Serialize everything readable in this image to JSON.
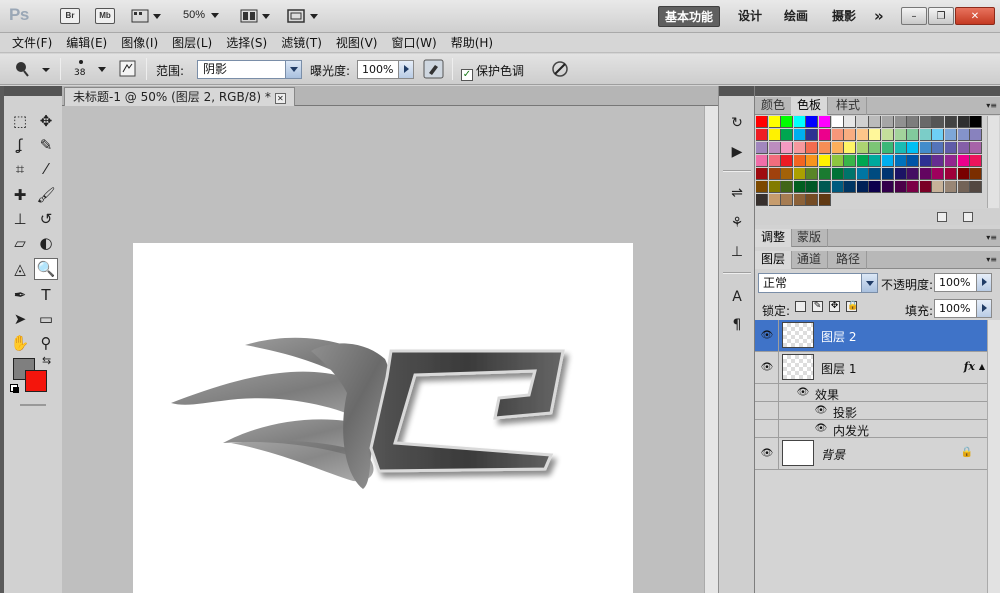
{
  "app": {
    "logo": "Ps",
    "bridge": "Br",
    "mini_bridge": "Mb",
    "zoom": "50%",
    "workspaces": [
      "基本功能",
      "设计",
      "绘画",
      "摄影"
    ],
    "more": "»"
  },
  "window_controls": {
    "minimize": "–",
    "restore": "❐",
    "close": "✕"
  },
  "menu": [
    "文件(F)",
    "编辑(E)",
    "图像(I)",
    "图层(L)",
    "选择(S)",
    "滤镜(T)",
    "视图(V)",
    "窗口(W)",
    "帮助(H)"
  ],
  "options": {
    "brush_size": "38",
    "range_label": "范围:",
    "range_value": "阴影",
    "exposure_label": "曝光度:",
    "exposure_value": "100%",
    "protect_tones_label": "保护色调",
    "protect_tones_checked": true
  },
  "document": {
    "tab_title": "未标题-1 @ 50% (图层 2, RGB/8) *",
    "close": "✕"
  },
  "tools": [
    {
      "name": "marquee-icon",
      "glyph": "⬚"
    },
    {
      "name": "move-icon",
      "glyph": "✥"
    },
    {
      "name": "lasso-icon",
      "glyph": "ʆ"
    },
    {
      "name": "quick-select-icon",
      "glyph": "✎"
    },
    {
      "name": "crop-icon",
      "glyph": "⌗"
    },
    {
      "name": "eyedropper-icon",
      "glyph": "⁄"
    },
    {
      "name": "healing-brush-icon",
      "glyph": "✚"
    },
    {
      "name": "brush-icon",
      "glyph": "🖌"
    },
    {
      "name": "clone-stamp-icon",
      "glyph": "⊥"
    },
    {
      "name": "history-brush-icon",
      "glyph": "↺"
    },
    {
      "name": "eraser-icon",
      "glyph": "▱"
    },
    {
      "name": "paint-bucket-icon",
      "glyph": "◐"
    },
    {
      "name": "blur-icon",
      "glyph": "◬"
    },
    {
      "name": "dodge-burn-icon",
      "glyph": "🔍"
    },
    {
      "name": "pen-icon",
      "glyph": "✒"
    },
    {
      "name": "type-icon",
      "glyph": "T"
    },
    {
      "name": "path-select-icon",
      "glyph": "➤"
    },
    {
      "name": "shape-icon",
      "glyph": "▭"
    },
    {
      "name": "hand-icon",
      "glyph": "✋"
    },
    {
      "name": "zoom-icon",
      "glyph": "⚲"
    }
  ],
  "colors": {
    "foreground": "#7f7f7f",
    "background": "#f4150c",
    "accent_selection": "#3f73c8"
  },
  "panels": {
    "swatch_tabs": [
      "颜色",
      "色板",
      "样式"
    ],
    "adjust_tabs": [
      "调整",
      "蒙版"
    ],
    "layer_tabs": [
      "图层",
      "通道",
      "路径"
    ],
    "blend_mode": "正常",
    "opacity_label": "不透明度:",
    "opacity_value": "100%",
    "lock_label": "锁定:",
    "fill_label": "填充:",
    "fill_value": "100%"
  },
  "layers": [
    {
      "name": "图层 2",
      "selected": true,
      "type": "layer"
    },
    {
      "name": "图层 1",
      "selected": false,
      "type": "layer",
      "fx": "fx"
    },
    {
      "name": "效果",
      "type": "effects-header"
    },
    {
      "name": "投影",
      "type": "effect"
    },
    {
      "name": "内发光",
      "type": "effect"
    },
    {
      "name": "背景",
      "selected": false,
      "type": "background"
    }
  ],
  "dock_icons": [
    "history-icon",
    "actions-icon",
    "brush-presets-icon",
    "clone-source-icon",
    "tool-presets-icon",
    "character-icon",
    "paragraph-icon"
  ],
  "swatch_colors": [
    "#ff0000",
    "#ffff00",
    "#00ff00",
    "#00ffff",
    "#0000ff",
    "#ff00ff",
    "#ffffff",
    "#e6e6e6",
    "#d0d0d0",
    "#bbbbbb",
    "#a6a6a6",
    "#919191",
    "#7d7d7d",
    "#696969",
    "#555555",
    "#424242",
    "#2f2f2f",
    "#000000",
    "#ee1d24",
    "#fff200",
    "#00a650",
    "#00aeef",
    "#2e3192",
    "#ec008c",
    "#f7977a",
    "#f9ad81",
    "#fdc68a",
    "#fff79a",
    "#c4df9b",
    "#a3d39c",
    "#82ca9d",
    "#7bcdc8",
    "#6ecff6",
    "#7ea7d8",
    "#8493ca",
    "#8882be",
    "#a187be",
    "#bc8dbf",
    "#f49ac1",
    "#f5989d",
    "#f26c4f",
    "#f68e55",
    "#fbaf5c",
    "#fff467",
    "#acd372",
    "#7cc576",
    "#3bb878",
    "#1abbb4",
    "#00bff3",
    "#438ccb",
    "#5574b9",
    "#605ca8",
    "#855fa8",
    "#a763a8",
    "#f06ea9",
    "#f26d7d",
    "#ed1c24",
    "#f26522",
    "#f7941d",
    "#fff200",
    "#8dc63f",
    "#39b54a",
    "#00a651",
    "#00a99d",
    "#00aeef",
    "#0072bc",
    "#0054a6",
    "#2e3192",
    "#662d91",
    "#92278f",
    "#ec008c",
    "#ed145b",
    "#9e0b0f",
    "#a0410d",
    "#a36209",
    "#aba000",
    "#598527",
    "#1a7b30",
    "#007236",
    "#00746b",
    "#0076a3",
    "#004b80",
    "#003471",
    "#1b1464",
    "#440e62",
    "#630460",
    "#9e005d",
    "#9e0039",
    "#790000",
    "#7b2e00",
    "#7d4900",
    "#827b00",
    "#406618",
    "#005e20",
    "#005826",
    "#005952",
    "#005b7f",
    "#003663",
    "#002157",
    "#0d004c",
    "#32004b",
    "#4b0049",
    "#7b0046",
    "#7a0026",
    "#c7b299",
    "#998675",
    "#736357",
    "#534741",
    "#37302d",
    "#c69c6d",
    "#a67c52",
    "#8c6239",
    "#754c24",
    "#603913"
  ]
}
